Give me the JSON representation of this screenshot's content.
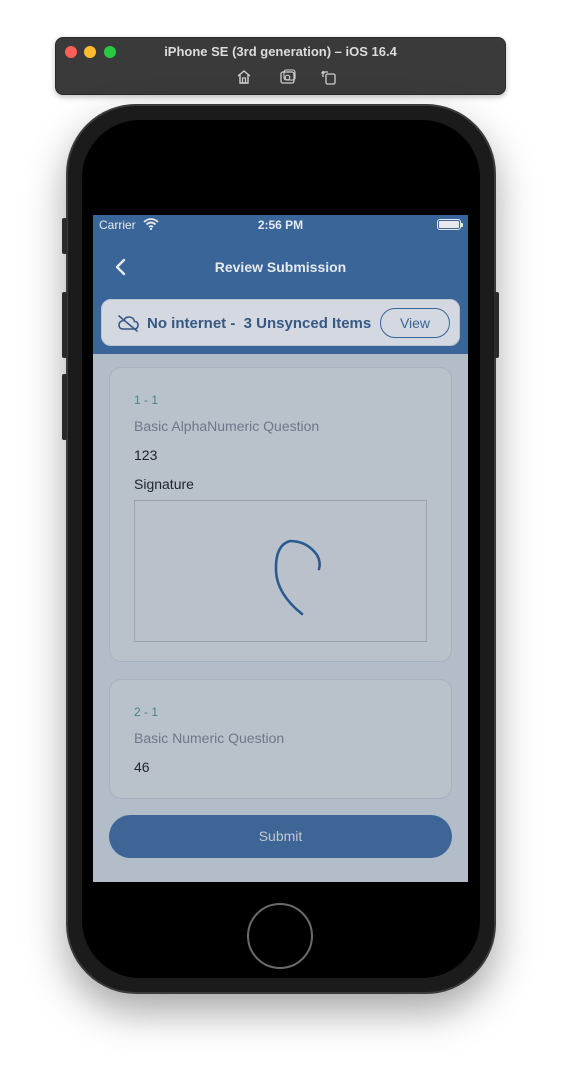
{
  "simulator": {
    "title": "iPhone SE (3rd generation) – iOS 16.4",
    "tools": [
      "home-icon",
      "screenshot-icon",
      "rotate-icon"
    ]
  },
  "status_bar": {
    "carrier": "Carrier",
    "time": "2:56 PM"
  },
  "nav": {
    "title": "Review Submission"
  },
  "banner": {
    "text": "No internet -  3 Unsynced Items",
    "view_label": "View",
    "icon": "cloud-offline-icon"
  },
  "questions": [
    {
      "number": "1 - 1",
      "question": "Basic AlphaNumeric Question",
      "answer": "123",
      "signature_label": "Signature"
    },
    {
      "number": "2 - 1",
      "question": "Basic Numeric Question",
      "answer": "46"
    }
  ],
  "submit_label": "Submit",
  "colors": {
    "primary": "#3f6da3",
    "accent_teal": "#52a8a0",
    "screen_bg": "#eef3f8"
  }
}
